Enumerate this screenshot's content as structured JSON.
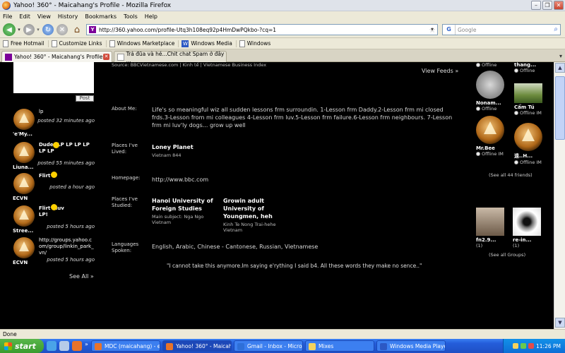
{
  "window": {
    "title": "Yahoo! 360° - Maicahang's Profile - Mozilla Firefox"
  },
  "menu": [
    "File",
    "Edit",
    "View",
    "History",
    "Bookmarks",
    "Tools",
    "Help"
  ],
  "nav": {
    "url": "http://360.yahoo.com/profile-Utq3h108eq92p4HmDwPQkbo-?cq=1",
    "search_placeholder": "Google"
  },
  "bookmarks": [
    "Free Hotmail",
    "Customize Links",
    "Windows Marketplace",
    "Windows Media",
    "Windows"
  ],
  "tabs": [
    {
      "label": "Yahoo! 360° - Maicahang's Profile",
      "active": true
    },
    {
      "label": "Trả đũa và hé...Chit chat Spam ở đây ...",
      "active": false
    }
  ],
  "page": {
    "source_line": "Source: BBCVietnamese.com | Kinh tế | Vietnamese Business Index",
    "view_feeds": "View Feeds »",
    "post_button": "Post",
    "feed": [
      {
        "user": "'e'My...",
        "message": "lp",
        "time": "posted 32 minutes ago",
        "smiley": false
      },
      {
        "user": "Liuna...",
        "message": "Dude! LP LP LP LP LP LP",
        "time": "posted 55 minutes ago",
        "smiley": true
      },
      {
        "user": "ECVN",
        "message": "Flirt",
        "time": "posted a hour ago",
        "smiley": true
      },
      {
        "user": "Stree...",
        "message": "Flirt I luv LP!",
        "time": "posted 5 hours ago",
        "smiley": true
      },
      {
        "user": "ECVN",
        "message": "http://groups.yahoo.com/group/linkin_park_vn/",
        "time": "posted 5 hours ago",
        "smiley": false
      }
    ],
    "see_all": "See All »",
    "profile": {
      "about_label": "About Me:",
      "about": "Life's so meaningful wiz all sudden lessons frm surroundin. 1-Lesson frm Daddy.2-Lesson frm mi closed frds.3-Lesson from mi colleagues 4-Lesson frm luv.5-Lesson frm failure.6-Lesson frm neighbours. 7-Lesson frm mi luv'ly dogs... grow up well",
      "lived_label": "Places I've Lived:",
      "lived_name": "Loney Planet",
      "lived_sub": "Vietnam 844",
      "homepage_label": "Homepage:",
      "homepage": "http://www.bbc.com",
      "studied_label": "Places I've Studied:",
      "study1_name": "Hanoi University of Foreign Studies",
      "study1_sub": "Main subject: Nga Ngo Vietnam",
      "study2_name": "Growin adult University of Youngmen, heh",
      "study2_sub": "Kinh Te Nong Trai-hehe Vietnam",
      "languages_label": "Languages Spoken:",
      "languages": "English, Arabic, Chinese - Cantonese, Russian, Vietnamese",
      "quote": "\"I cannot take this anymore.Im saying e'rything I said b4. All these words they make no sence..\""
    },
    "friends": [
      {
        "name": "",
        "status": "Offline"
      },
      {
        "name": "thang...",
        "status": "Offline"
      },
      {
        "name": "Nonam...",
        "status": "Offline"
      },
      {
        "name": "Cẩm Tú",
        "status": "Offline IM"
      },
      {
        "name": "Mr.Bee",
        "status": "Offline IM"
      },
      {
        "name": "遠..H...",
        "status": "Offline IM"
      }
    ],
    "see_friends": "(See all 44 friends)",
    "groups": [
      {
        "name": "fn2.9...",
        "count": "(1)"
      },
      {
        "name": "re-in...",
        "count": "(1)"
      }
    ],
    "see_groups": "(See all Groups)"
  },
  "status": "Done",
  "taskbar": {
    "start": "start",
    "items": [
      {
        "label": "MDC (maicahang) - e...",
        "active": false,
        "icon_color": "#e8732a"
      },
      {
        "label": "Yahoo! 360° - Maicah...",
        "active": true,
        "icon_color": "#e8732a"
      },
      {
        "label": "Gmail - Inbox - Micros...",
        "active": false,
        "icon_color": "#2e6fd8"
      },
      {
        "label": "Mixes",
        "active": false,
        "icon_color": "#f4d35e"
      },
      {
        "label": "Windows Media Player",
        "active": false,
        "icon_color": "#2c58c4"
      }
    ],
    "clock": "11:26 PM"
  }
}
